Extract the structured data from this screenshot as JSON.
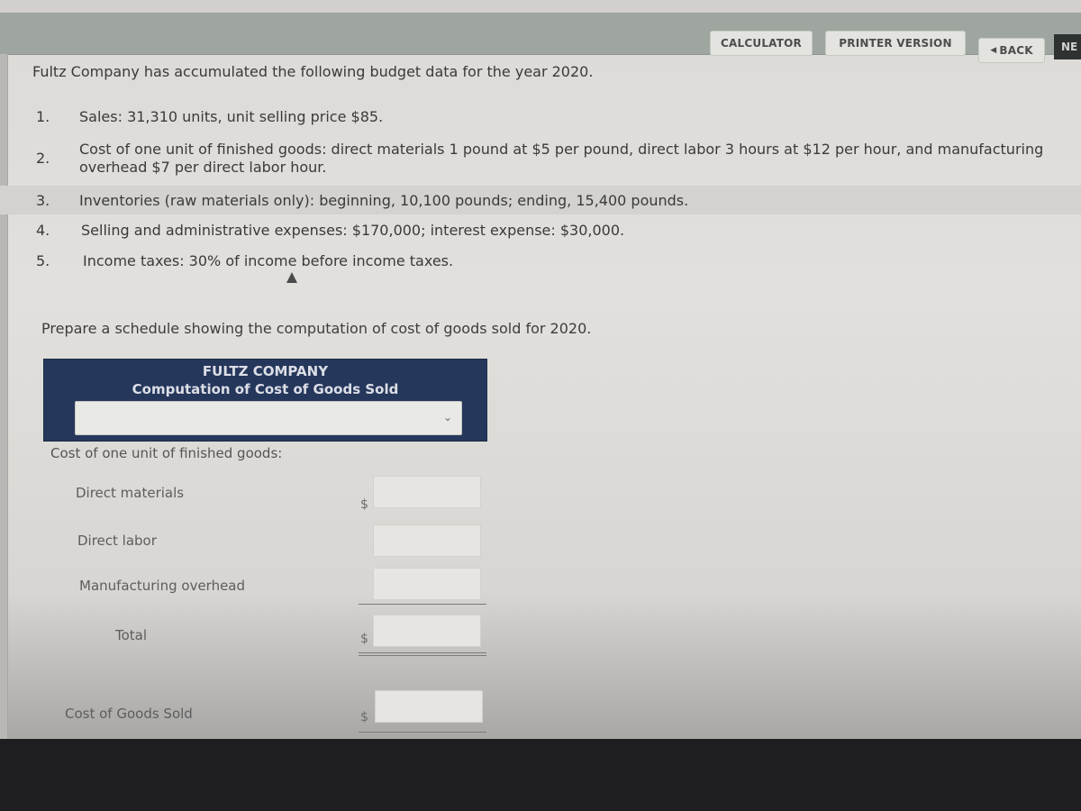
{
  "toolbar": {
    "calculator": "CALCULATOR",
    "printer_version": "PRINTER VERSION",
    "back": "BACK",
    "back_icon": "chevron-left-icon",
    "next_partial": "NE"
  },
  "problem": {
    "intro": "Fultz Company has accumulated the following budget data for the year 2020.",
    "items": [
      {
        "num": "1.",
        "text": "Sales: 31,310 units, unit selling price $85."
      },
      {
        "num": "2.",
        "text": "Cost of one unit of finished goods: direct materials 1 pound at $5 per pound, direct labor 3 hours at $12 per hour, and manufacturing overhead $7 per direct labor hour."
      },
      {
        "num": "3.",
        "text": "Inventories (raw materials only): beginning, 10,100 pounds; ending, 15,400 pounds."
      },
      {
        "num": "4.",
        "text": "Selling and administrative expenses: $170,000; interest expense: $30,000."
      },
      {
        "num": "5.",
        "text": "Income taxes: 30% of income before income taxes."
      }
    ],
    "prompt": "Prepare a schedule showing the computation of cost of goods sold for 2020."
  },
  "schedule": {
    "company": "FULTZ COMPANY",
    "title": "Computation of Cost of Goods Sold",
    "period_select": {
      "value": "",
      "icon": "chevron-down-icon"
    },
    "section_label": "Cost of one unit of finished goods:",
    "rows": [
      {
        "label": "Direct materials",
        "currency": "$",
        "value": ""
      },
      {
        "label": "Direct labor",
        "currency": "",
        "value": ""
      },
      {
        "label": "Manufacturing overhead",
        "currency": "",
        "value": ""
      },
      {
        "label": "Total",
        "currency": "$",
        "value": ""
      },
      {
        "label": "Cost of Goods Sold",
        "currency": "$",
        "value": ""
      }
    ]
  }
}
